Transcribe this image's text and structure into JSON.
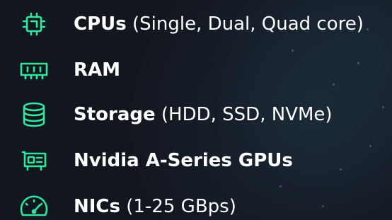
{
  "accent_color": "#2ee59d",
  "features": [
    {
      "icon": "cpu-icon",
      "name": "CPUs",
      "detail": "(Single, Dual, Quad core)"
    },
    {
      "icon": "ram-icon",
      "name": "RAM",
      "detail": ""
    },
    {
      "icon": "storage-icon",
      "name": "Storage",
      "detail": "(HDD, SSD, NVMe)"
    },
    {
      "icon": "gpu-icon",
      "name": "Nvidia A-Series GPUs",
      "detail": ""
    },
    {
      "icon": "nic-icon",
      "name": "NICs",
      "detail": "(1-25 GBps)"
    }
  ]
}
